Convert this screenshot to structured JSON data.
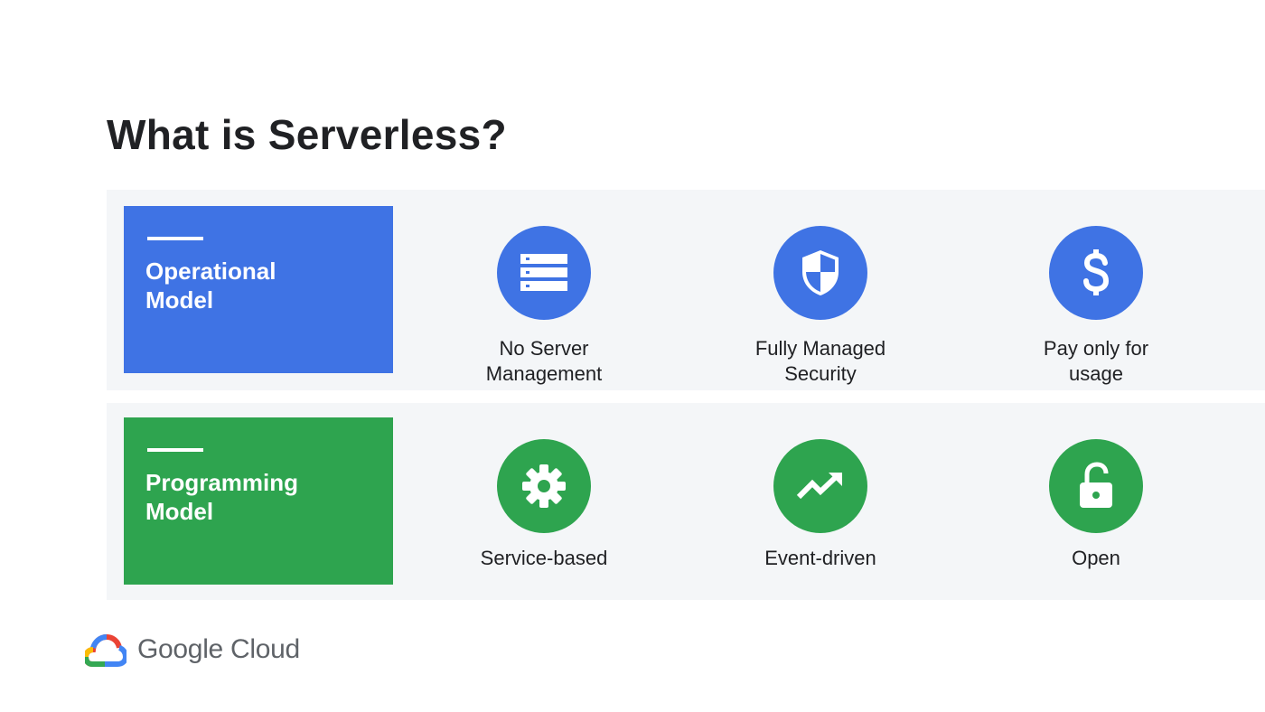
{
  "slide": {
    "title": "What is Serverless?"
  },
  "colors": {
    "operational": "#3f73e4",
    "programming": "#2ea44f",
    "text": "#202124",
    "row_background": "#f4f6f8"
  },
  "rows": [
    {
      "label": "Operational\nModel",
      "color": "#3f73e4",
      "items": [
        {
          "caption": "No Server\nManagement",
          "icon": "server-stack-icon"
        },
        {
          "caption": "Fully Managed\nSecurity",
          "icon": "shield-icon"
        },
        {
          "caption": "Pay only for\nusage",
          "icon": "dollar-icon"
        }
      ]
    },
    {
      "label": "Programming\nModel",
      "color": "#2ea44f",
      "items": [
        {
          "caption": "Service-based",
          "icon": "gear-icon"
        },
        {
          "caption": "Event-driven",
          "icon": "trending-up-icon"
        },
        {
          "caption": "Open",
          "icon": "unlocked-padlock-icon"
        }
      ]
    }
  ],
  "footer": {
    "logo_text": "Google Cloud",
    "logo_icon": "google-cloud-logo-icon"
  }
}
